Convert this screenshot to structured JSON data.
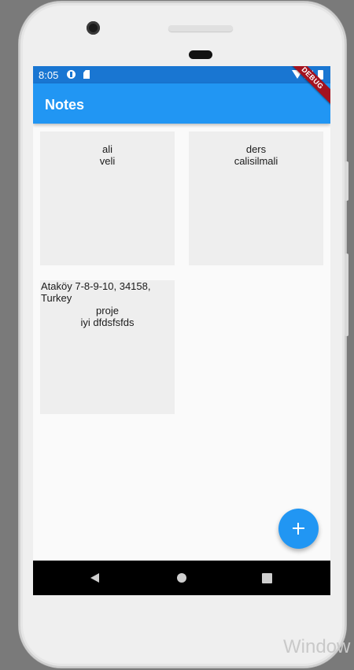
{
  "status_bar": {
    "time": "8:05"
  },
  "app_bar": {
    "title": "Notes"
  },
  "debug_banner": {
    "label": "DEBUG"
  },
  "notes": [
    {
      "text": "ali\nveli"
    },
    {
      "text": "ders\ncalisilmali"
    },
    {
      "address": "Ataköy 7-8-9-10, 34158,\nTurkey",
      "text": "proje\niyi dfdsfsfds"
    }
  ],
  "fab": {
    "icon": "plus-icon",
    "label": "+"
  },
  "nav_bar": {
    "icons": [
      "back-icon",
      "home-icon",
      "recents-icon"
    ]
  },
  "watermark": {
    "text": "Window"
  },
  "colors": {
    "status_bar": "#1976d2",
    "app_bar": "#2196f3",
    "fab": "#2196f3",
    "card": "#eeeeee",
    "debug_banner": "#a3121f"
  }
}
